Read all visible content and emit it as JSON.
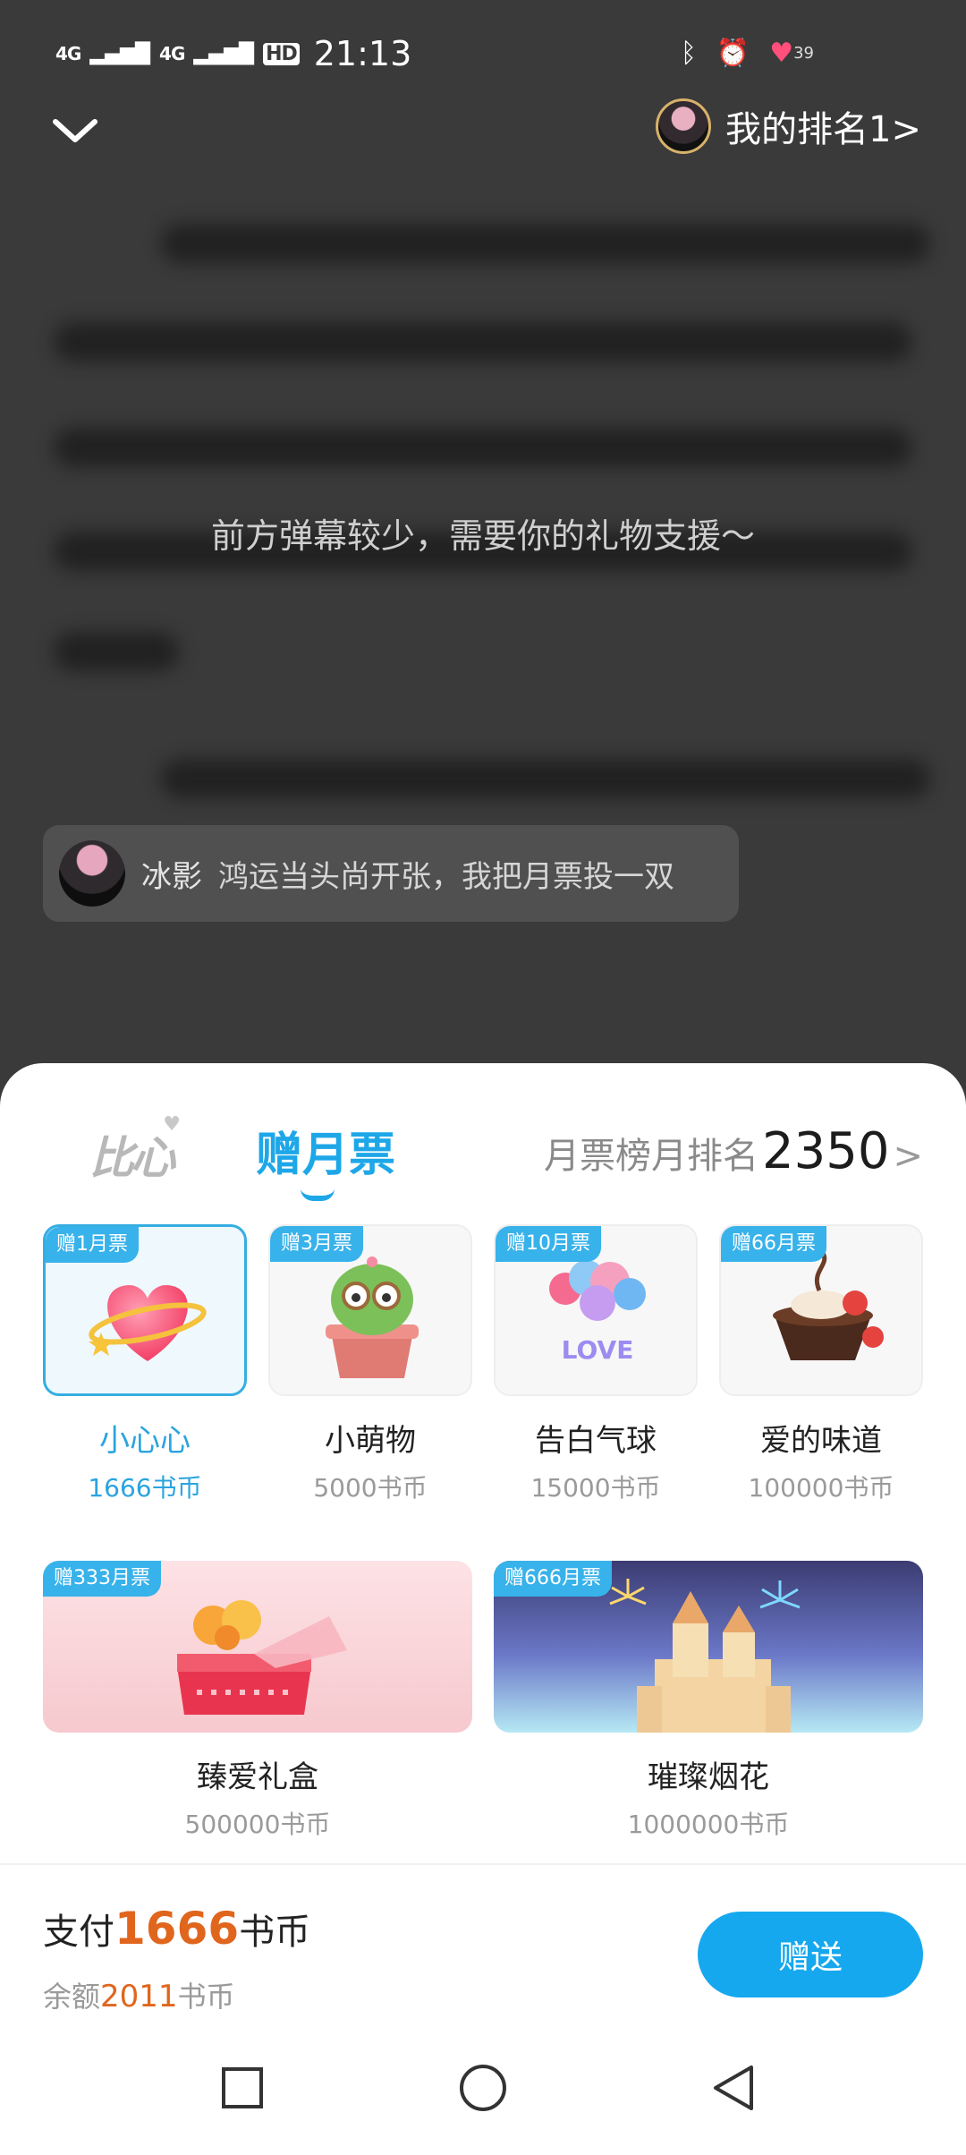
{
  "status_bar": {
    "signal1": "4G",
    "signal2": "4G",
    "hd": "HD",
    "time": "21:13",
    "battery": "39"
  },
  "header": {
    "my_rank": "我的排名1>"
  },
  "reader": {
    "prompt": "前方弹幕较少，需要你的礼物支援～"
  },
  "danmaku": {
    "user": "冰影",
    "text": "鸿运当头尚开张，我把月票投一双"
  },
  "sheet": {
    "tab_bixin": "比心",
    "tab_yuepiao": "赠月票",
    "rank_label": "月票榜月排名",
    "rank_value": "2350",
    "rank_arrow": ">",
    "gifts": [
      {
        "badge": "赠1月票",
        "name": "小心心",
        "price": "1666书币",
        "selected": true
      },
      {
        "badge": "赠3月票",
        "name": "小萌物",
        "price": "5000书币"
      },
      {
        "badge": "赠10月票",
        "name": "告白气球",
        "price": "15000书币",
        "balloon_text": "LOVE"
      },
      {
        "badge": "赠66月票",
        "name": "爱的味道",
        "price": "100000书币"
      },
      {
        "badge": "赠333月票",
        "name": "臻爱礼盒",
        "price": "500000书币"
      },
      {
        "badge": "赠666月票",
        "name": "璀璨烟花",
        "price": "1000000书币"
      }
    ],
    "pay_prefix": "支付",
    "pay_amount": "1666",
    "pay_unit": "书币",
    "balance_prefix": "余额",
    "balance_amount": "2011",
    "balance_unit": "书币",
    "send_label": "赠送"
  },
  "colors": {
    "accent": "#1ea7e8",
    "price_orange": "#e0661d",
    "overlay": "#3a3a3a"
  }
}
